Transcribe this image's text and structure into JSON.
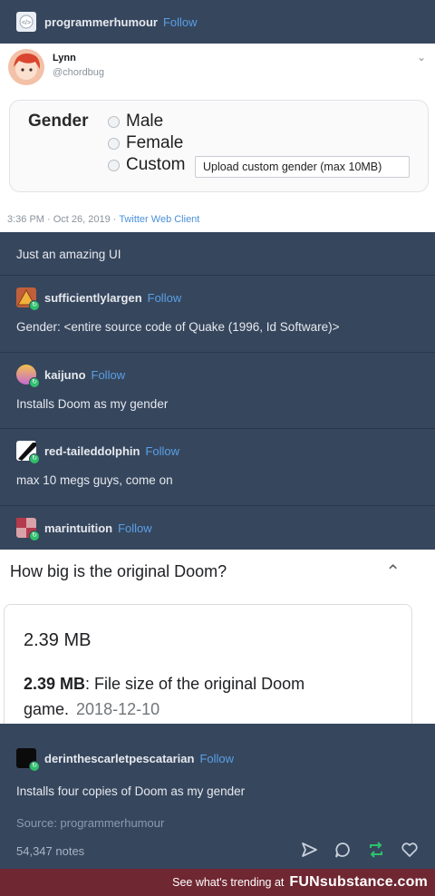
{
  "op": {
    "blog": "programmerhumour",
    "follow": "Follow"
  },
  "tweet": {
    "name": "Lynn",
    "handle": "@chordbug",
    "form": {
      "label": "Gender",
      "options": [
        "Male",
        "Female",
        "Custom"
      ],
      "upload_label": "Upload custom gender (max 10MB)"
    },
    "time": "3:36 PM · Oct 26, 2019 · ",
    "client": "Twitter Web Client"
  },
  "caption": "Just an amazing UI",
  "replies": [
    {
      "blog": "sufficientlylargen",
      "follow": "Follow",
      "text": "Gender: <entire source code of Quake (1996, Id Software)>"
    },
    {
      "blog": "kaijuno",
      "follow": "Follow",
      "text": "Installs Doom as my gender"
    },
    {
      "blog": "red-taileddolphin",
      "follow": "Follow",
      "text": "max 10 megs guys, come on"
    },
    {
      "blog": "marintuition",
      "follow": "Follow"
    },
    {
      "blog": "derinthescarletpescatarian",
      "follow": "Follow",
      "text": "Installs four copies of Doom as my gender"
    }
  ],
  "google": {
    "question": "How big is the original Doom?",
    "answer_big": "2.39 MB",
    "answer_bold": "2.39 MB",
    "answer_rest": ": File size of the original Doom game.",
    "answer_date": "2018-12-10"
  },
  "source": "Source: programmerhumour",
  "notes": "54,347 notes",
  "banner": {
    "trending": "See what's trending at",
    "logo": "FUNsubstance.com"
  },
  "colors": {
    "dashboard": "#36465d",
    "follow": "#5aa0e6",
    "reblog": "#2fc06c",
    "banner": "#6f2732"
  }
}
